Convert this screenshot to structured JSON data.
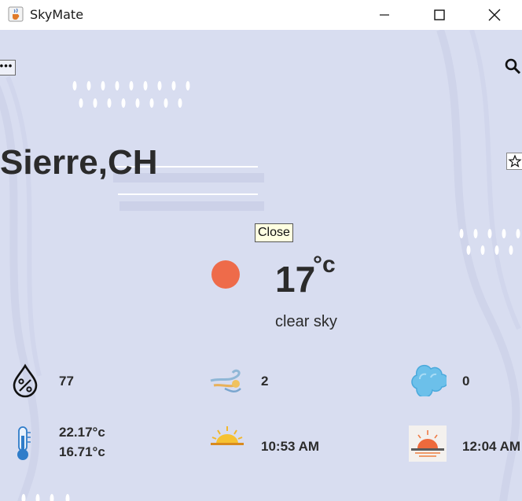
{
  "window": {
    "title": "SkyMate",
    "app_icon": "java-cup-icon"
  },
  "window_controls": {
    "minimize": "minimize-icon",
    "maximize": "maximize-icon",
    "close": "close-icon"
  },
  "toolbar": {
    "menu_label": "•••",
    "search_icon": "search-icon",
    "favorite_icon": "star-icon"
  },
  "location": {
    "city": "Sierre,CH"
  },
  "tooltip": {
    "text": "Close"
  },
  "current": {
    "temperature": "17",
    "unit": "°c",
    "description": "clear sky",
    "icon": "sun-icon",
    "accent_color": "#ee6b4a"
  },
  "stats": {
    "humidity": {
      "icon": "humidity-icon",
      "value": "77"
    },
    "wind": {
      "icon": "wind-icon",
      "value": "2"
    },
    "clouds": {
      "icon": "cloud-icon",
      "value": "0"
    },
    "temp_range": {
      "icon": "thermometer-icon",
      "max": "22.17°c",
      "min": "16.71°c"
    },
    "sunrise": {
      "icon": "sunrise-icon",
      "value": "10:53 AM"
    },
    "sunset": {
      "icon": "sunset-icon",
      "value": "12:04 AM"
    }
  },
  "colors": {
    "background": "#d8ddf0",
    "text": "#2b2b2b"
  }
}
